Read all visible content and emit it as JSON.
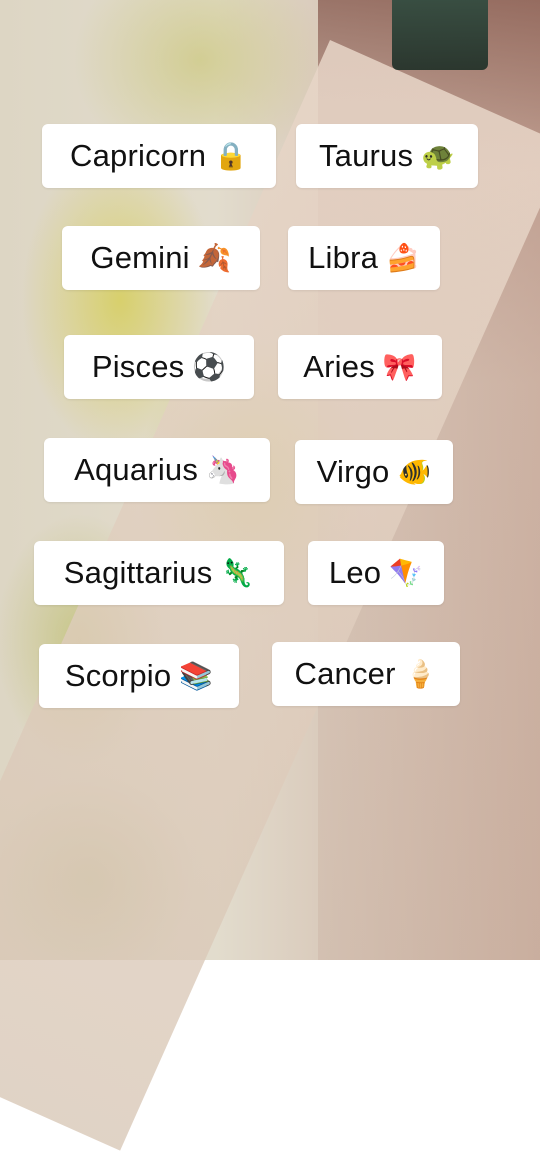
{
  "tags": [
    {
      "sign": "Capricorn",
      "emoji": "🔒",
      "icon": "lock-icon"
    },
    {
      "sign": "Taurus",
      "emoji": "🐢",
      "icon": "turtle-icon"
    },
    {
      "sign": "Gemini",
      "emoji": "🍂",
      "icon": "fallen-leaf-icon"
    },
    {
      "sign": "Libra",
      "emoji": "🍰",
      "icon": "cake-icon"
    },
    {
      "sign": "Pisces",
      "emoji": "⚽",
      "icon": "soccer-ball-icon"
    },
    {
      "sign": "Aries",
      "emoji": "🎀",
      "icon": "ribbon-icon"
    },
    {
      "sign": "Aquarius",
      "emoji": "🦄",
      "icon": "unicorn-icon"
    },
    {
      "sign": "Virgo",
      "emoji": "🐠",
      "icon": "tropical-fish-icon"
    },
    {
      "sign": "Sagittarius",
      "emoji": "🦎",
      "icon": "lizard-icon"
    },
    {
      "sign": "Leo",
      "emoji": "🪁",
      "icon": "kite-icon"
    },
    {
      "sign": "Scorpio",
      "emoji": "📚",
      "icon": "books-icon"
    },
    {
      "sign": "Cancer",
      "emoji": "🍦",
      "icon": "ice-cream-icon"
    }
  ]
}
